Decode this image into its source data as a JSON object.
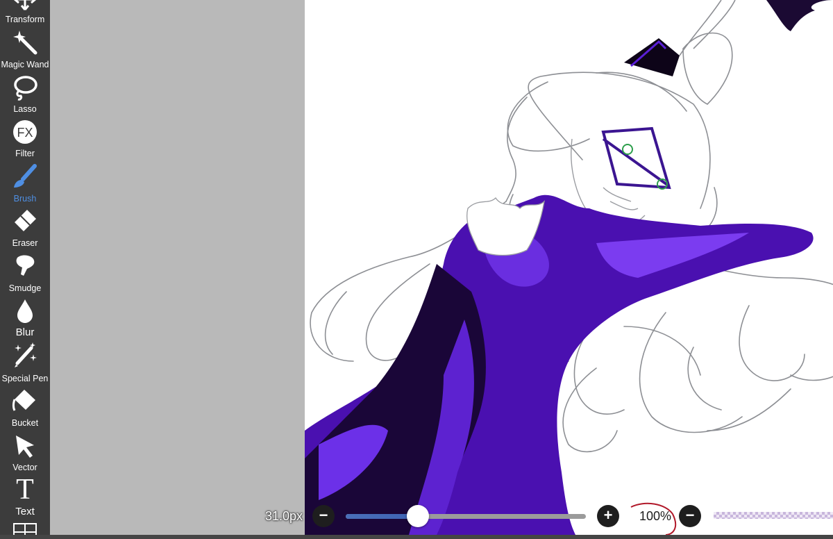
{
  "toolbar": {
    "tools": [
      {
        "name": "Transform",
        "icon": "transform-icon",
        "active": false
      },
      {
        "name": "Magic Wand",
        "icon": "magic-wand-icon",
        "active": false
      },
      {
        "name": "Lasso",
        "icon": "lasso-icon",
        "active": false
      },
      {
        "name": "Filter",
        "icon": "fx-icon",
        "active": false
      },
      {
        "name": "Brush",
        "icon": "brush-icon",
        "active": true
      },
      {
        "name": "Eraser",
        "icon": "eraser-icon",
        "active": false
      },
      {
        "name": "Smudge",
        "icon": "smudge-icon",
        "active": false
      },
      {
        "name": "Blur",
        "icon": "blur-drop-icon",
        "active": false
      },
      {
        "name": "Special Pen",
        "icon": "special-pen-icon",
        "active": false
      },
      {
        "name": "Bucket",
        "icon": "bucket-icon",
        "active": false
      },
      {
        "name": "Vector",
        "icon": "vector-arrow-icon",
        "active": false
      },
      {
        "name": "Text",
        "icon": "text-icon",
        "active": false
      }
    ]
  },
  "brush_bar": {
    "size_label": "31.0px",
    "size_fraction": 0.3,
    "opacity_label": "100%",
    "minus_glyph": "−",
    "plus_glyph": "+"
  },
  "colors": {
    "toolbar_bg": "#3c3c3c",
    "active_tool": "#4f8fe3",
    "workspace_bg": "#b9b9b9",
    "slider_fill": "#3e63b4",
    "artwork_purple": "#4a10b0"
  }
}
